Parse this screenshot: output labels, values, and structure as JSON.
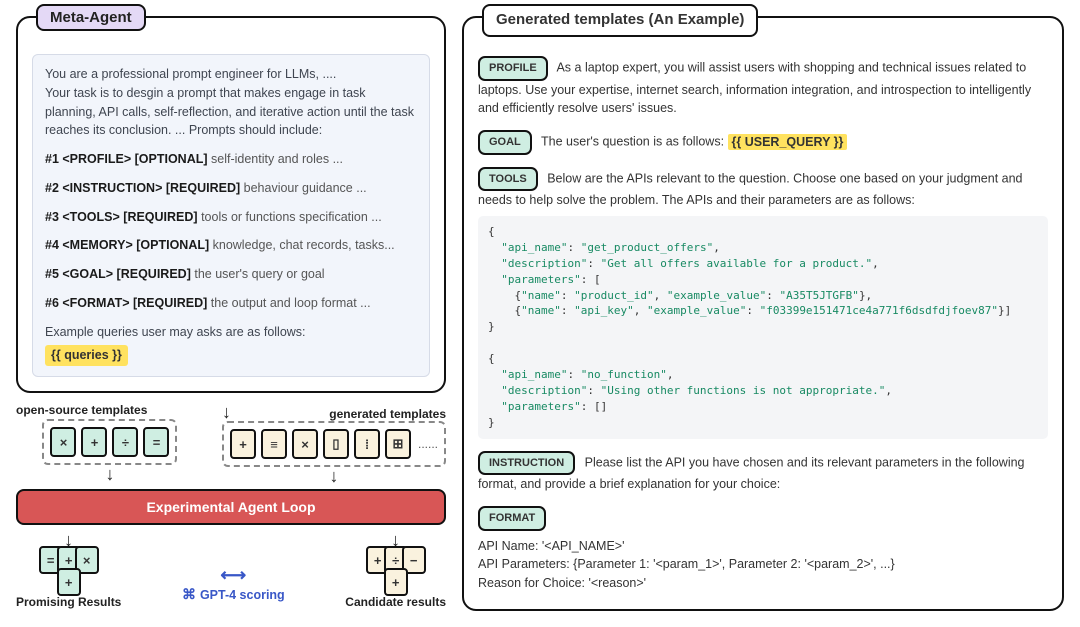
{
  "left": {
    "panel_title": "Meta-Agent",
    "intro_1": "You are a professional prompt engineer for LLMs, ....",
    "intro_2": "Your task is to desgin a prompt that makes engage in task planning, API calls, self-reflection, and iterative action until the task reaches its conclusion.  ... Prompts should include:",
    "reqs": [
      {
        "prefix": "#1 <PROFILE> [OPTIONAL] ",
        "desc": "self-identity and roles ..."
      },
      {
        "prefix": "#2 <INSTRUCTION> [REQUIRED] ",
        "desc": "behaviour guidance ..."
      },
      {
        "prefix": "#3 <TOOLS> [REQUIRED] ",
        "desc": "tools or functions specification ..."
      },
      {
        "prefix": "#4 <MEMORY> [OPTIONAL] ",
        "desc": "knowledge, chat records, tasks..."
      },
      {
        "prefix": "#5 <GOAL> [REQUIRED] ",
        "desc": "the user's query or goal"
      },
      {
        "prefix": "#6 <FORMAT> [REQUIRED] ",
        "desc": "the output and loop format ..."
      }
    ],
    "example_label": "Example queries user may asks are as follows:",
    "queries_chip": "{{ queries }}",
    "opensource_label": "open-source templates",
    "generated_label": "generated templates",
    "loop_label": "Experimental Agent Loop",
    "promising_label": "Promising Results",
    "candidate_label": "Candidate results",
    "gpt_label": "GPT-4 scoring",
    "ellipsis": "......"
  },
  "right": {
    "panel_title": "Generated templates (An Example)",
    "profile_label": "PROFILE",
    "profile_text": "As a laptop expert, you will assist users with shopping and technical issues related to laptops. Use your expertise, internet search, information integration, and introspection to intelligently and efficiently resolve users' issues.",
    "goal_label": "GOAL",
    "goal_text": "The user's question is as follows: ",
    "goal_placeholder": "{{ USER_QUERY }}",
    "tools_label": "TOOLS",
    "tools_text": "Below are the APIs relevant to the question. Choose one based on your judgment and needs to help solve the problem. The APIs and their parameters are as follows:",
    "instruction_label": "INSTRUCTION",
    "instruction_text": "Please list the API you have chosen and its relevant parameters in the following format, and provide a brief explanation for your choice:",
    "format_label": "FORMAT",
    "format_lines": [
      "API Name: '<API_NAME>'",
      "API Parameters: {Parameter 1: '<param_1>', Parameter 2: '<param_2>', ...}",
      "Reason for Choice: '<reason>'"
    ],
    "apis": [
      {
        "api_name": "get_product_offers",
        "description": "Get all offers available for a product.",
        "parameters": [
          {
            "name": "product_id",
            "example_value": "A35T5JTGFB"
          },
          {
            "name": "api_key",
            "example_value": "f03399e151471ce4a771f6dsdfdjfoev87"
          }
        ]
      },
      {
        "api_name": "no_function",
        "description": "Using other functions is not appropriate.",
        "parameters": []
      }
    ]
  }
}
